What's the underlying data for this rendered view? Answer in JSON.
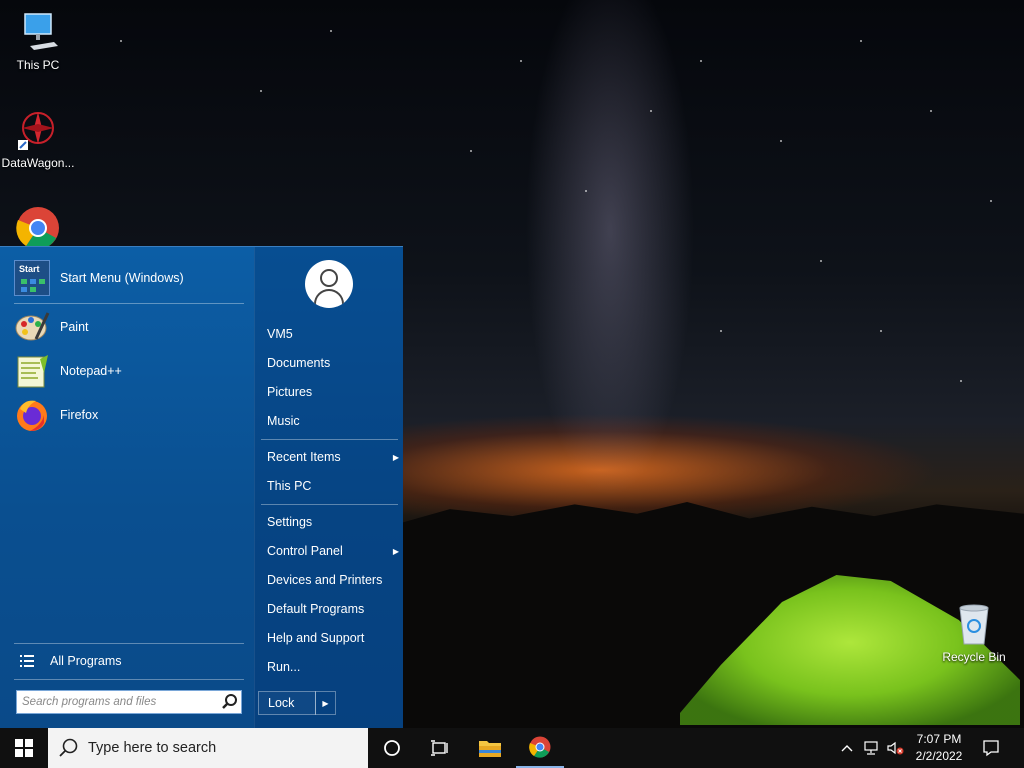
{
  "desktop": {
    "icons": [
      {
        "label": "This PC",
        "icon": "computer-icon"
      },
      {
        "label": "DataWagon...",
        "icon": "datawagon-icon"
      },
      {
        "label": "",
        "icon": "chrome-icon"
      },
      {
        "label": "Recycle Bin",
        "icon": "recycle-bin-icon"
      }
    ]
  },
  "start_menu": {
    "header_item": {
      "label": "Start Menu (Windows)",
      "icon_text": "Start"
    },
    "pinned": [
      {
        "label": "Paint"
      },
      {
        "label": "Notepad++"
      },
      {
        "label": "Firefox"
      }
    ],
    "all_programs": "All Programs",
    "search": {
      "placeholder": "Search programs and files"
    },
    "right": {
      "user": "VM5",
      "links_top": [
        "Documents",
        "Pictures",
        "Music"
      ],
      "links_mid": [
        {
          "label": "Recent Items",
          "submenu": true
        },
        {
          "label": "This PC",
          "submenu": false
        }
      ],
      "links_bottom": [
        {
          "label": "Settings",
          "submenu": false
        },
        {
          "label": "Control Panel",
          "submenu": true
        },
        {
          "label": "Devices and Printers",
          "submenu": false
        },
        {
          "label": "Default Programs",
          "submenu": false
        },
        {
          "label": "Help and Support",
          "submenu": false
        },
        {
          "label": "Run...",
          "submenu": false
        }
      ],
      "lock_label": "Lock",
      "arrow": "▶"
    }
  },
  "taskbar": {
    "search_placeholder": "Type here to search",
    "clock": {
      "time": "7:07 PM",
      "date": "2/2/2022"
    },
    "tray_chevron": "^"
  },
  "colors": {
    "start_menu_bg": "#0c5ea6",
    "taskbar_bg": "#101010",
    "tent_green": "#8fd62a"
  }
}
